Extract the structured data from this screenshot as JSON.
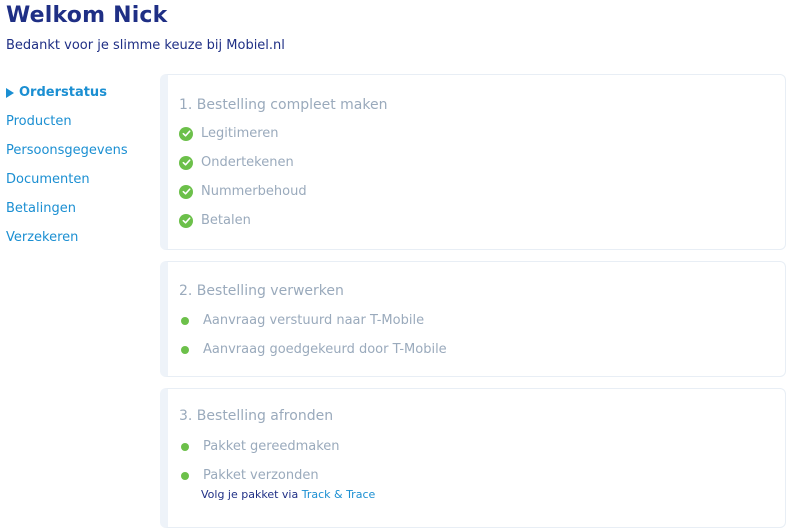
{
  "header": {
    "title": "Welkom Nick",
    "subtitle": "Bedankt voor je slimme keuze bij Mobiel.nl"
  },
  "sidebar": {
    "items": [
      {
        "label": "Orderstatus",
        "active": true
      },
      {
        "label": "Producten"
      },
      {
        "label": "Persoonsgegevens"
      },
      {
        "label": "Documenten"
      },
      {
        "label": "Betalingen"
      },
      {
        "label": "Verzekeren"
      }
    ]
  },
  "sections": [
    {
      "title": "1. Bestelling compleet maken",
      "steps": [
        "Legitimeren",
        "Ondertekenen",
        "Nummerbehoud",
        "Betalen"
      ]
    },
    {
      "title": "2. Bestelling verwerken",
      "steps": [
        "Aanvraag verstuurd naar T-Mobile",
        "Aanvraag goedgekeurd door T-Mobile"
      ]
    },
    {
      "title": "3. Bestelling afronden",
      "steps": [
        "Pakket gereedmaken",
        "Pakket verzonden"
      ],
      "note_prefix": "Volg je pakket via",
      "note_link": "Track & Trace"
    }
  ],
  "colors": {
    "title": "#1f2f85",
    "link": "#1b8fd2",
    "muted": "#9aaabc",
    "success": "#6cc04a"
  }
}
